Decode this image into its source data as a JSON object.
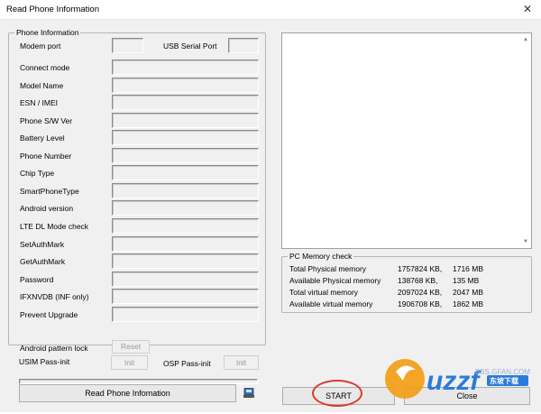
{
  "window": {
    "title": "Read Phone Information",
    "close_glyph": "✕"
  },
  "phone_info": {
    "title": "Phone Information",
    "modem_port_label": "Modem port",
    "usb_serial_port_label": "USB Serial Port",
    "fields": [
      "Connect mode",
      "Model Name",
      "ESN / IMEI",
      "Phone S/W Ver",
      "Battery Level",
      "Phone Number",
      "Chip Type",
      "SmartPhoneType",
      "Android version",
      "LTE DL Mode check",
      "SetAuthMark",
      "GetAuthMark",
      "Password",
      "IFXNVDB (INF only)",
      "Prevent Upgrade"
    ],
    "android_pattern_lock_label": "Android pattern lock",
    "reset_label": "Reset",
    "usim_label": "USIM Pass-init",
    "usim_init_label": "Init",
    "osp_label": "OSP Pass-init",
    "osp_init_label": "Init"
  },
  "actions": {
    "read_label": "Read Phone Infomation",
    "start_label": "START",
    "close_label": "Close"
  },
  "pc_memory": {
    "title": "PC Memory check",
    "rows": [
      {
        "label": "Total Physical memory",
        "kb": "1757824 KB,",
        "mb": "1716 MB"
      },
      {
        "label": "Available Physical memory",
        "kb": "138768 KB,",
        "mb": "135 MB"
      },
      {
        "label": "Total virtual memory",
        "kb": "2097024 KB,",
        "mb": "2047 MB"
      },
      {
        "label": "Available virtual memory",
        "kb": "1906708 KB,",
        "mb": "1862 MB"
      }
    ]
  },
  "watermark": {
    "brand": "uzzf",
    "sub": "东坡下载",
    "site": "BBS.GFAN.COM"
  },
  "colors": {
    "annotation_red": "#d93a2f",
    "brand_orange": "#f39c12",
    "brand_blue": "#2b7bd9"
  }
}
